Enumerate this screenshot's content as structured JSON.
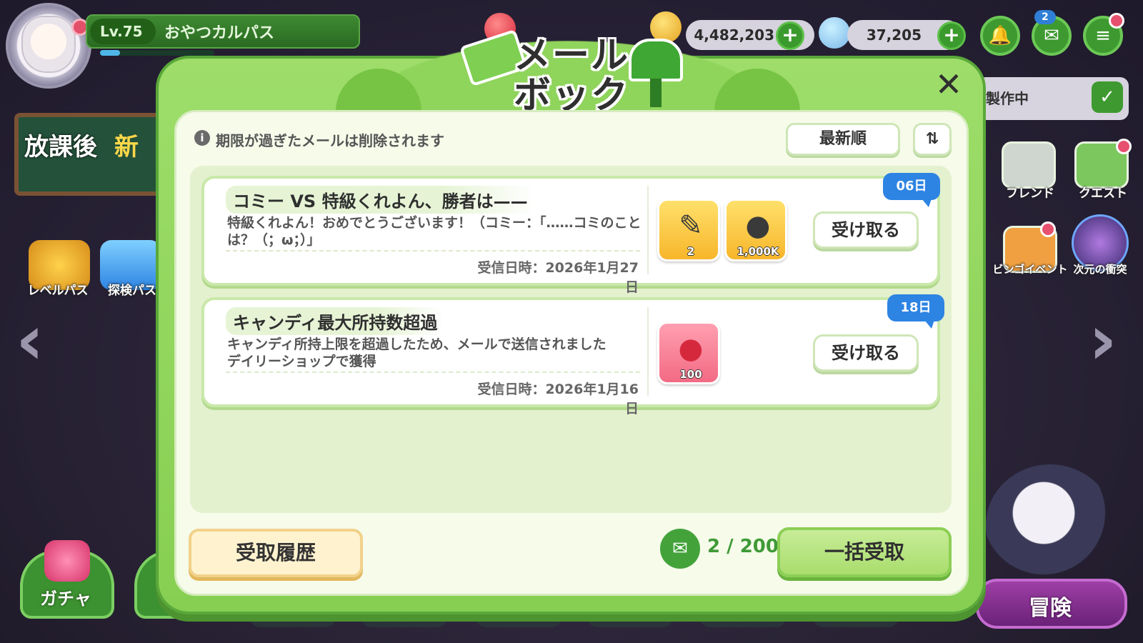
{
  "hud": {
    "level": "Lv.75",
    "pass_name": "おやつカルパス",
    "coins": "4,482,203",
    "crystals": "37,205",
    "notification_count": "2",
    "crafting_label": "製作中",
    "side_menu": {
      "friends": "フレンド",
      "quest": "クエスト",
      "bingo_event": "ビンゴイベント",
      "dimension_clash": "次元の衝突",
      "level_pass": "レベルパス",
      "explore_pass": "探検パス"
    },
    "banner_left": {
      "text1": "放課後",
      "text2": "新"
    },
    "bottom_nav": {
      "gacha": "ガチャ",
      "adventure": "冒険"
    }
  },
  "mailbox": {
    "title_line1": "メール",
    "title_line2": "ボックス",
    "notice": "期限が過ぎたメールは削除されます",
    "sort_label": "最新順",
    "mails": [
      {
        "title": "コミー VS 特級くれよん、勝者は——",
        "body": "特級くれよん！おめでとうございます！（コミー：「……コミのことは？（；ω；）」",
        "received": "受信日時：2026年1月27日",
        "days_left": "06日",
        "items": [
          {
            "icon": "crayon-icon",
            "count": "2"
          },
          {
            "icon": "gold-coin-icon",
            "count": "1,000K"
          }
        ],
        "receive_label": "受け取る"
      },
      {
        "title": "キャンディ最大所持数超過",
        "body": "キャンディ所持上限を超過したため、メールで送信されました\nデイリーショップで獲得",
        "received": "受信日時：2026年1月16日",
        "days_left": "18日",
        "items": [
          {
            "icon": "red-candy-icon",
            "count": "100"
          }
        ],
        "receive_label": "受け取る"
      }
    ],
    "history_label": "受取履歴",
    "mail_count": "2 / 200",
    "claim_all_label": "一括受取"
  },
  "colors": {
    "frame_green": "#86cf52",
    "accent_blue": "#2d84e3",
    "text_dark": "#2f2f2f"
  }
}
